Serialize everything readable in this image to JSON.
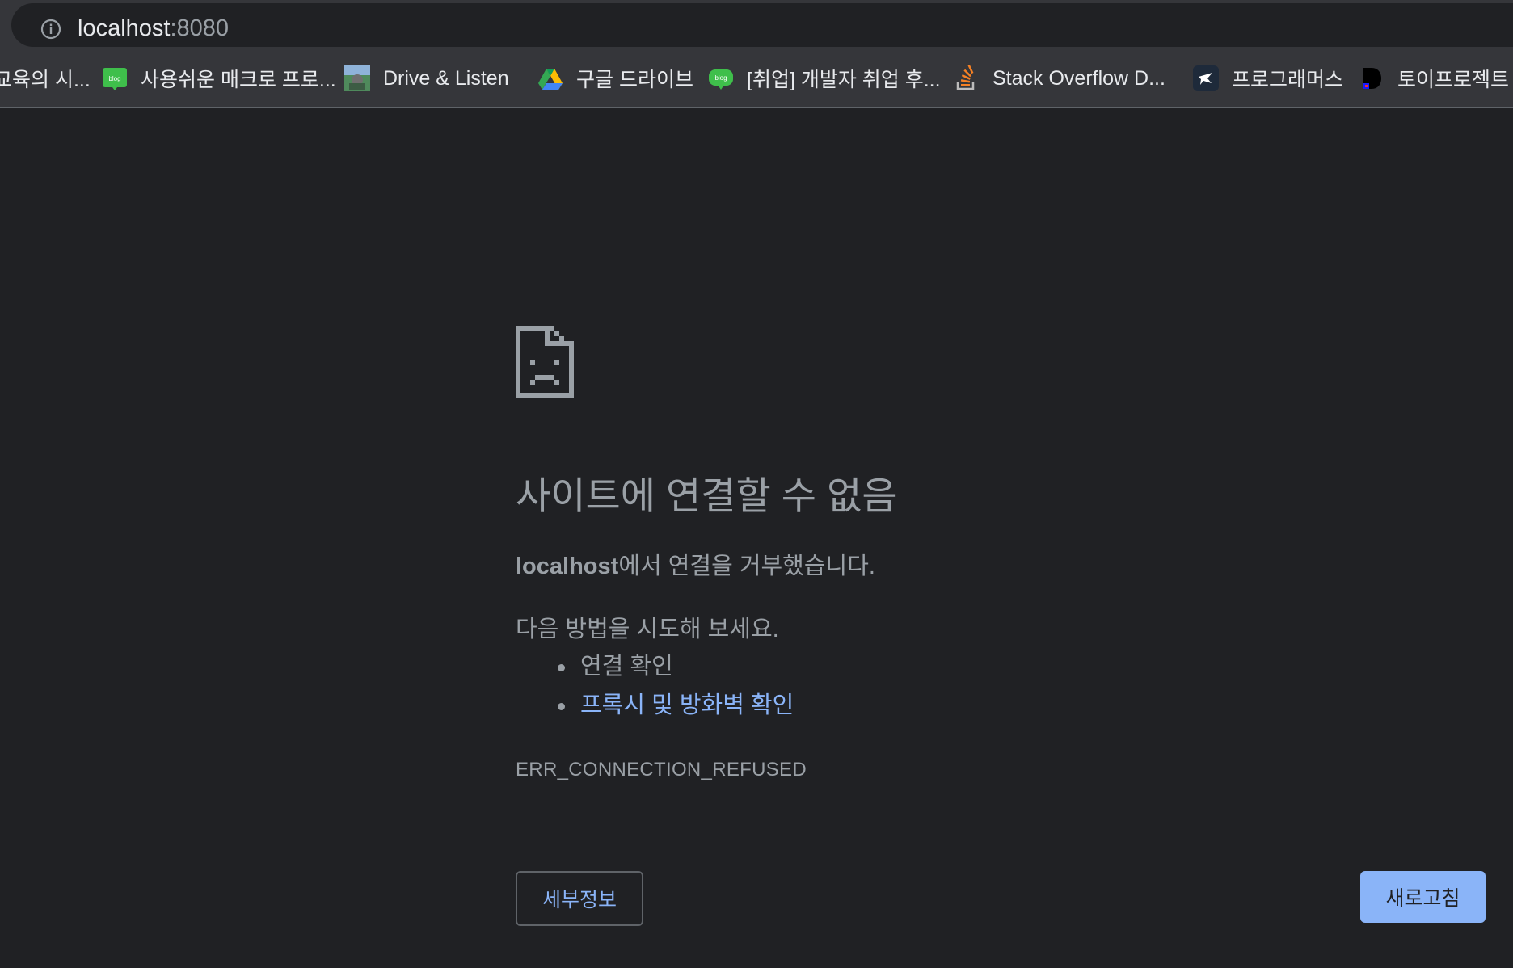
{
  "address_bar": {
    "host": "localhost",
    "port": ":8080"
  },
  "bookmarks": [
    {
      "label": "교육의 시...",
      "icon": "none"
    },
    {
      "label": "사용쉬운 매크로 프로...",
      "icon": "naver-blog-icon",
      "icon_text": "blog"
    },
    {
      "label": "Drive & Listen",
      "icon": "drive-listen-icon"
    },
    {
      "label": "구글 드라이브",
      "icon": "google-drive-icon"
    },
    {
      "label": "[취업] 개발자 취업 후...",
      "icon": "blog-icon",
      "icon_text": "blog"
    },
    {
      "label": "Stack Overflow D...",
      "icon": "stack-overflow-icon"
    },
    {
      "label": "프로그래머스",
      "icon": "programmers-icon"
    },
    {
      "label": "토이프로젝트",
      "icon": "toy-project-icon"
    }
  ],
  "error_page": {
    "title": "사이트에 연결할 수 없음",
    "host_bold": "localhost",
    "host_rest": "에서 연결을 거부했습니다.",
    "try_title": "다음 방법을 시도해 보세요.",
    "suggestions": [
      {
        "label": "연결 확인",
        "is_link": false
      },
      {
        "label": "프록시 및 방화벽 확인",
        "is_link": true
      }
    ],
    "error_code": "ERR_CONNECTION_REFUSED",
    "details_button": "세부정보",
    "reload_button": "새로고침"
  },
  "colors": {
    "background": "#202124",
    "toolbar": "#35363a",
    "text_secondary": "#9aa0a6",
    "link": "#8ab4f8",
    "reload_button": "#8ab4f8"
  }
}
